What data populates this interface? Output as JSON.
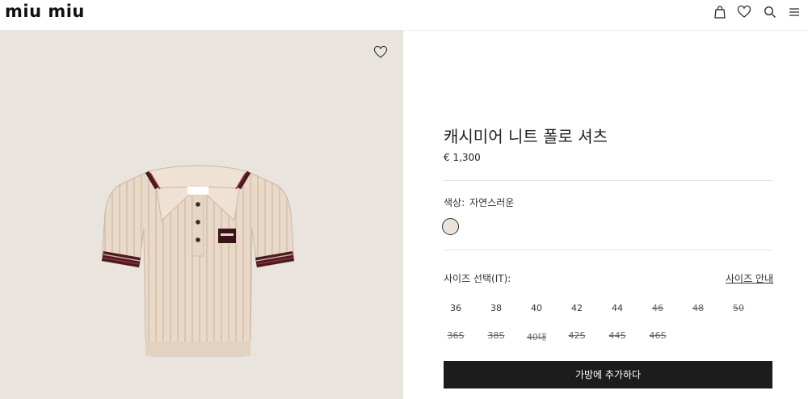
{
  "header": {
    "logo": "miu miu",
    "icons": [
      "bag-icon",
      "heart-icon",
      "search-icon",
      "menu-icon"
    ]
  },
  "product": {
    "title": "캐시미어 니트 폴로 셔츠",
    "price": "€ 1,300",
    "color_label": "색상:",
    "color_value": "자연스러운",
    "swatch_color": "#ece2d7",
    "size_label": "사이즈 선택(IT):",
    "size_guide": "사이즈 안내",
    "sizes_row1": [
      {
        "label": "36",
        "available": true
      },
      {
        "label": "38",
        "available": true
      },
      {
        "label": "40",
        "available": true
      },
      {
        "label": "42",
        "available": true
      },
      {
        "label": "44",
        "available": true
      },
      {
        "label": "46",
        "available": false
      },
      {
        "label": "48",
        "available": false
      },
      {
        "label": "50",
        "available": false
      }
    ],
    "sizes_row2": [
      {
        "label": "36S",
        "available": false
      },
      {
        "label": "38S",
        "available": false
      },
      {
        "label": "40대",
        "available": false
      },
      {
        "label": "42S",
        "available": false
      },
      {
        "label": "44S",
        "available": false
      },
      {
        "label": "46S",
        "available": false
      }
    ],
    "add_to_bag": "가방에 추가하다"
  },
  "colors": {
    "image_bg": "#e9e5de",
    "button_bg": "#1c1c1c",
    "shirt": "#ead9c8",
    "trim_dark": "#4a1a22",
    "trim_red": "#a02a2f"
  }
}
